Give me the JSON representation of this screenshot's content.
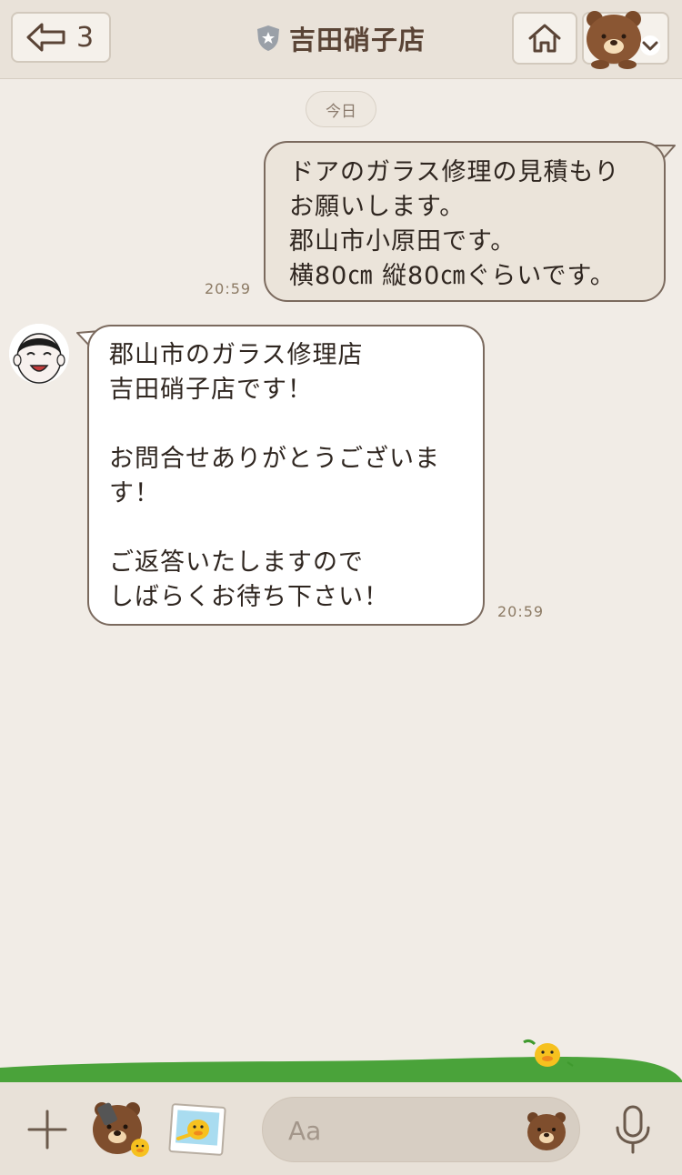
{
  "header": {
    "back_count": "3",
    "title": "吉田硝子店"
  },
  "chat": {
    "date_label": "今日",
    "messages": [
      {
        "direction": "outgoing",
        "text": "ドアのガラス修理の見積もり\nお願いします。\n郡山市小原田です。\n横80㎝ 縦80㎝ぐらいです。",
        "time": "20:59"
      },
      {
        "direction": "incoming",
        "text": "郡山市のガラス修理店\n吉田硝子店です！\n\nお問合せありがとうございま\nす！\n\nご返答いたしますので\nしばらくお待ち下さい！",
        "time": "20:59"
      }
    ]
  },
  "input_bar": {
    "placeholder": "Aa"
  },
  "icons": {
    "back": "back-arrow-icon",
    "shield": "shield-star-icon",
    "home": "home-icon",
    "menu": "bear-chevron-icon",
    "plus": "plus-icon",
    "sticker": "bear-sticker-icon",
    "photo": "photo-icon",
    "emoji": "bear-emoji-icon",
    "mic": "microphone-icon"
  },
  "colors": {
    "background": "#f1ece6",
    "header": "#e9e2d9",
    "outgoing_bubble": "#ebe4da",
    "incoming_bubble": "#ffffff",
    "bubble_border": "#7b6a5e",
    "grass": "#4aa33a"
  }
}
